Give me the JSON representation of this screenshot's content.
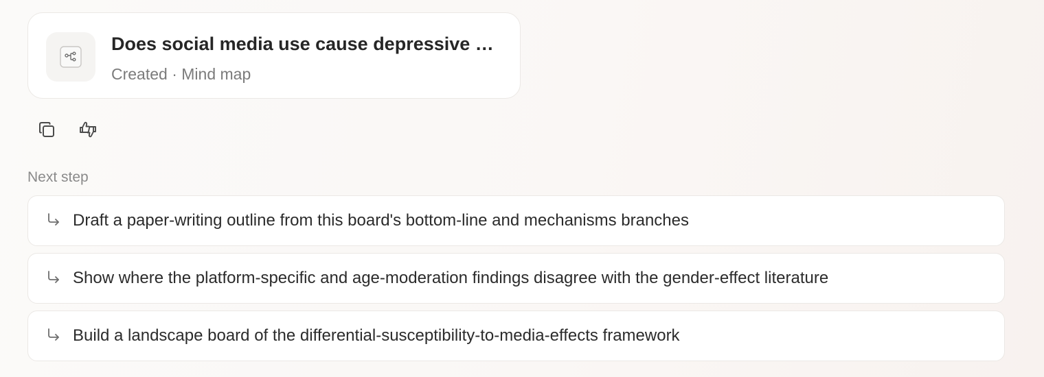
{
  "artifact": {
    "title": "Does social media use cause depressive symptoms in adolescents?",
    "meta": "Created · Mind map",
    "icon": "mind-map-icon"
  },
  "actions": {
    "copy_icon": "copy-icon",
    "feedback_icon": "thumbs-up-down-icon"
  },
  "next_step": {
    "label": "Next step",
    "suggestions": [
      {
        "text": "Draft a paper-writing outline from this board's bottom-line and mechanisms branches",
        "icon": "arrow-turn-down-right-icon"
      },
      {
        "text": "Show where the platform-specific and age-moderation findings disagree with the gender-effect literature",
        "icon": "arrow-turn-down-right-icon"
      },
      {
        "text": "Build a landscape board of the differential-susceptibility-to-media-effects framework",
        "icon": "arrow-turn-down-right-icon"
      }
    ]
  }
}
